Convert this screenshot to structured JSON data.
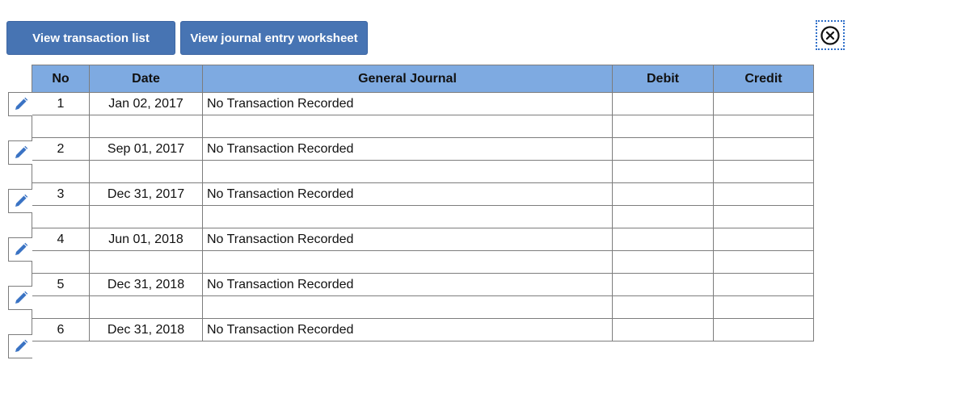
{
  "toolbar": {
    "view_transaction_list": "View transaction list",
    "view_journal_entry_worksheet": "View journal entry worksheet"
  },
  "close_icon": "close-circle-icon",
  "table": {
    "headers": {
      "no": "No",
      "date": "Date",
      "journal": "General Journal",
      "debit": "Debit",
      "credit": "Credit"
    },
    "rows": [
      {
        "no": "1",
        "date": "Jan 02, 2017",
        "journal": "No Transaction Recorded",
        "debit": "",
        "credit": ""
      },
      {
        "no": "",
        "date": "",
        "journal": "",
        "debit": "",
        "credit": ""
      },
      {
        "no": "2",
        "date": "Sep 01, 2017",
        "journal": "No Transaction Recorded",
        "debit": "",
        "credit": ""
      },
      {
        "no": "",
        "date": "",
        "journal": "",
        "debit": "",
        "credit": ""
      },
      {
        "no": "3",
        "date": "Dec 31, 2017",
        "journal": "No Transaction Recorded",
        "debit": "",
        "credit": ""
      },
      {
        "no": "",
        "date": "",
        "journal": "",
        "debit": "",
        "credit": ""
      },
      {
        "no": "4",
        "date": "Jun 01, 2018",
        "journal": "No Transaction Recorded",
        "debit": "",
        "credit": ""
      },
      {
        "no": "",
        "date": "",
        "journal": "",
        "debit": "",
        "credit": ""
      },
      {
        "no": "5",
        "date": "Dec 31, 2018",
        "journal": "No Transaction Recorded",
        "debit": "",
        "credit": ""
      },
      {
        "no": "",
        "date": "",
        "journal": "",
        "debit": "",
        "credit": ""
      },
      {
        "no": "6",
        "date": "Dec 31, 2018",
        "journal": "No Transaction Recorded",
        "debit": "",
        "credit": ""
      }
    ]
  },
  "colors": {
    "button": "#4774b3",
    "header": "#7eaae1",
    "icon": "#3a73c4"
  }
}
